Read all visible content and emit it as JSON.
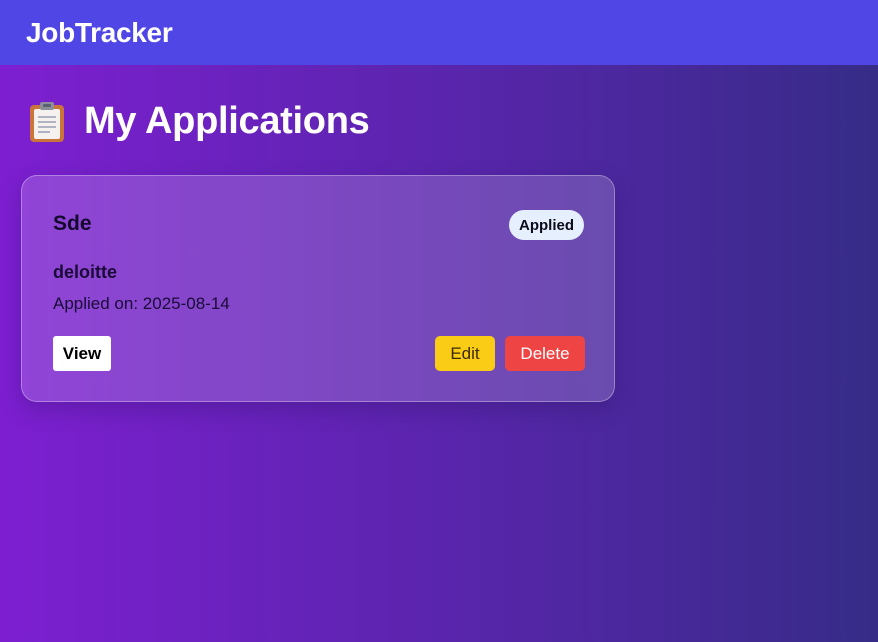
{
  "navbar": {
    "brand": "JobTracker"
  },
  "page": {
    "title": "My Applications",
    "title_icon": "clipboard-icon"
  },
  "applications": [
    {
      "title": "Sde",
      "status": "Applied",
      "company": "deloitte",
      "applied_on": "Applied on: 2025-08-14",
      "actions": {
        "view": "View",
        "edit": "Edit",
        "delete": "Delete"
      }
    }
  ],
  "colors": {
    "navbar": "#4f46e5",
    "edit": "#facc15",
    "delete": "#ef4444",
    "badge": "#e6effd"
  }
}
